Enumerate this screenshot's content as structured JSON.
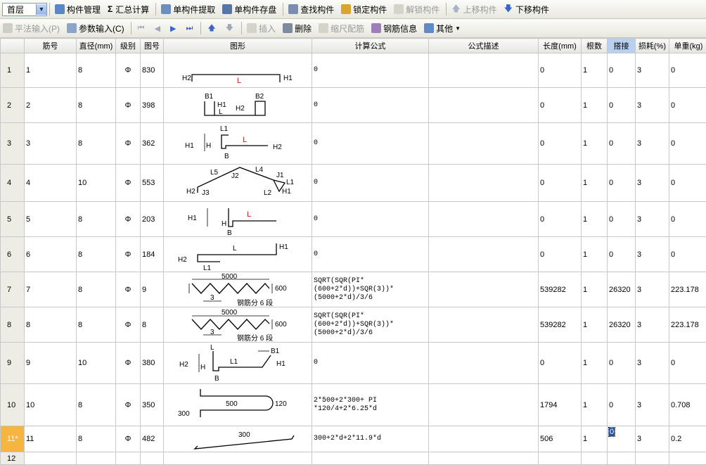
{
  "toolbar1": {
    "floor": "首层",
    "component_manage": "构件管理",
    "sum_calc": "汇总计算",
    "single_extract": "单构件提取",
    "single_save": "单构件存盘",
    "find": "查找构件",
    "lock": "锁定构件",
    "unlock": "解锁构件",
    "move_up": "上移构件",
    "move_down": "下移构件"
  },
  "toolbar2": {
    "flat_input": "平法输入(P)",
    "param_input": "参数输入(C)",
    "insert": "插入",
    "delete": "删除",
    "scale_rebar": "缩尺配筋",
    "rebar_info": "钢筋信息",
    "other": "其他"
  },
  "grid": {
    "headers": [
      "",
      "筋号",
      "直径(mm)",
      "级别",
      "图号",
      "图形",
      "计算公式",
      "公式描述",
      "长度(mm)",
      "根数",
      "搭接",
      "损耗(%)",
      "单重(kg)"
    ],
    "rows": [
      {
        "n": "1",
        "bar": "1",
        "dia": "8",
        "grade": "Φ",
        "fig": "830",
        "formula": "0",
        "desc": "",
        "len": "0",
        "cnt": "1",
        "lap": "0",
        "loss": "3",
        "wt": "0"
      },
      {
        "n": "2",
        "bar": "2",
        "dia": "8",
        "grade": "Φ",
        "fig": "398",
        "formula": "0",
        "desc": "",
        "len": "0",
        "cnt": "1",
        "lap": "0",
        "loss": "3",
        "wt": "0"
      },
      {
        "n": "3",
        "bar": "3",
        "dia": "8",
        "grade": "Φ",
        "fig": "362",
        "formula": "0",
        "desc": "",
        "len": "0",
        "cnt": "1",
        "lap": "0",
        "loss": "3",
        "wt": "0"
      },
      {
        "n": "4",
        "bar": "4",
        "dia": "10",
        "grade": "Φ",
        "fig": "553",
        "formula": "0",
        "desc": "",
        "len": "0",
        "cnt": "1",
        "lap": "0",
        "loss": "3",
        "wt": "0"
      },
      {
        "n": "5",
        "bar": "5",
        "dia": "8",
        "grade": "Φ",
        "fig": "203",
        "formula": "0",
        "desc": "",
        "len": "0",
        "cnt": "1",
        "lap": "0",
        "loss": "3",
        "wt": "0"
      },
      {
        "n": "6",
        "bar": "6",
        "dia": "8",
        "grade": "Φ",
        "fig": "184",
        "formula": "0",
        "desc": "",
        "len": "0",
        "cnt": "1",
        "lap": "0",
        "loss": "3",
        "wt": "0"
      },
      {
        "n": "7",
        "bar": "7",
        "dia": "8",
        "grade": "Φ",
        "fig": "9",
        "formula": "SQRT(SQR(PI*(600+2*d))+SQR(3))*(5000+2*d)/3/6",
        "desc": "",
        "len": "539282",
        "cnt": "1",
        "lap": "26320",
        "loss": "3",
        "wt": "223.178"
      },
      {
        "n": "8",
        "bar": "8",
        "dia": "8",
        "grade": "Φ",
        "fig": "8",
        "formula": "SQRT(SQR(PI*(600+2*d))+SQR(3))*(5000+2*d)/3/6",
        "desc": "",
        "len": "539282",
        "cnt": "1",
        "lap": "26320",
        "loss": "3",
        "wt": "223.178"
      },
      {
        "n": "9",
        "bar": "9",
        "dia": "10",
        "grade": "Φ",
        "fig": "380",
        "formula": "0",
        "desc": "",
        "len": "0",
        "cnt": "1",
        "lap": "0",
        "loss": "3",
        "wt": "0"
      },
      {
        "n": "10",
        "bar": "10",
        "dia": "8",
        "grade": "Φ",
        "fig": "350",
        "formula": "2*500+2*300+ PI *120/4+2*6.25*d",
        "desc": "",
        "len": "1794",
        "cnt": "1",
        "lap": "0",
        "loss": "3",
        "wt": "0.708"
      },
      {
        "n": "11*",
        "bar": "11",
        "dia": "8",
        "grade": "Φ",
        "fig": "482",
        "formula": "300+2*d+2*11.9*d",
        "desc": "",
        "len": "506",
        "cnt": "1",
        "lap": "0",
        "loss": "3",
        "wt": "0.2"
      },
      {
        "n": "12",
        "bar": "",
        "dia": "",
        "grade": "",
        "fig": "",
        "formula": "",
        "desc": "",
        "len": "",
        "cnt": "",
        "lap": "",
        "loss": "",
        "wt": ""
      }
    ]
  },
  "shapes": {
    "s1": {
      "h2": "H2",
      "l": "L",
      "h1": "H1"
    },
    "s2": {
      "b1": "B1",
      "b2": "B2",
      "h1": "H1",
      "h2": "H2",
      "l": "L"
    },
    "s3": {
      "l1": "L1",
      "l": "L",
      "h1": "H1",
      "h": "H",
      "h2": "H2",
      "b": "B"
    },
    "s4": {
      "l5": "L5",
      "l4": "L4",
      "j2": "J2",
      "j1": "J1",
      "l1": "L1",
      "h2": "H2",
      "j3": "J3",
      "l2": "L2",
      "h1": "H1"
    },
    "s5": {
      "h1": "H1",
      "h": "H",
      "l": "L",
      "b": "B"
    },
    "s6": {
      "l": "L",
      "h1": "H1",
      "h2": "H2",
      "l1": "L1"
    },
    "s7": {
      "len": "5000",
      "h": "600",
      "pitch": "3",
      "caption": "钢筋分 6 段"
    },
    "s8": {
      "len": "5000",
      "h": "600",
      "pitch": "3",
      "caption": "钢筋分 6 段"
    },
    "s9": {
      "l": "L",
      "b1": "B1",
      "h2": "H2",
      "h": "H",
      "l1": "L1",
      "h1": "H1",
      "b": "B"
    },
    "s10": {
      "top": "500",
      "side": "120",
      "left": "300"
    },
    "s11": {
      "len": "300"
    }
  }
}
